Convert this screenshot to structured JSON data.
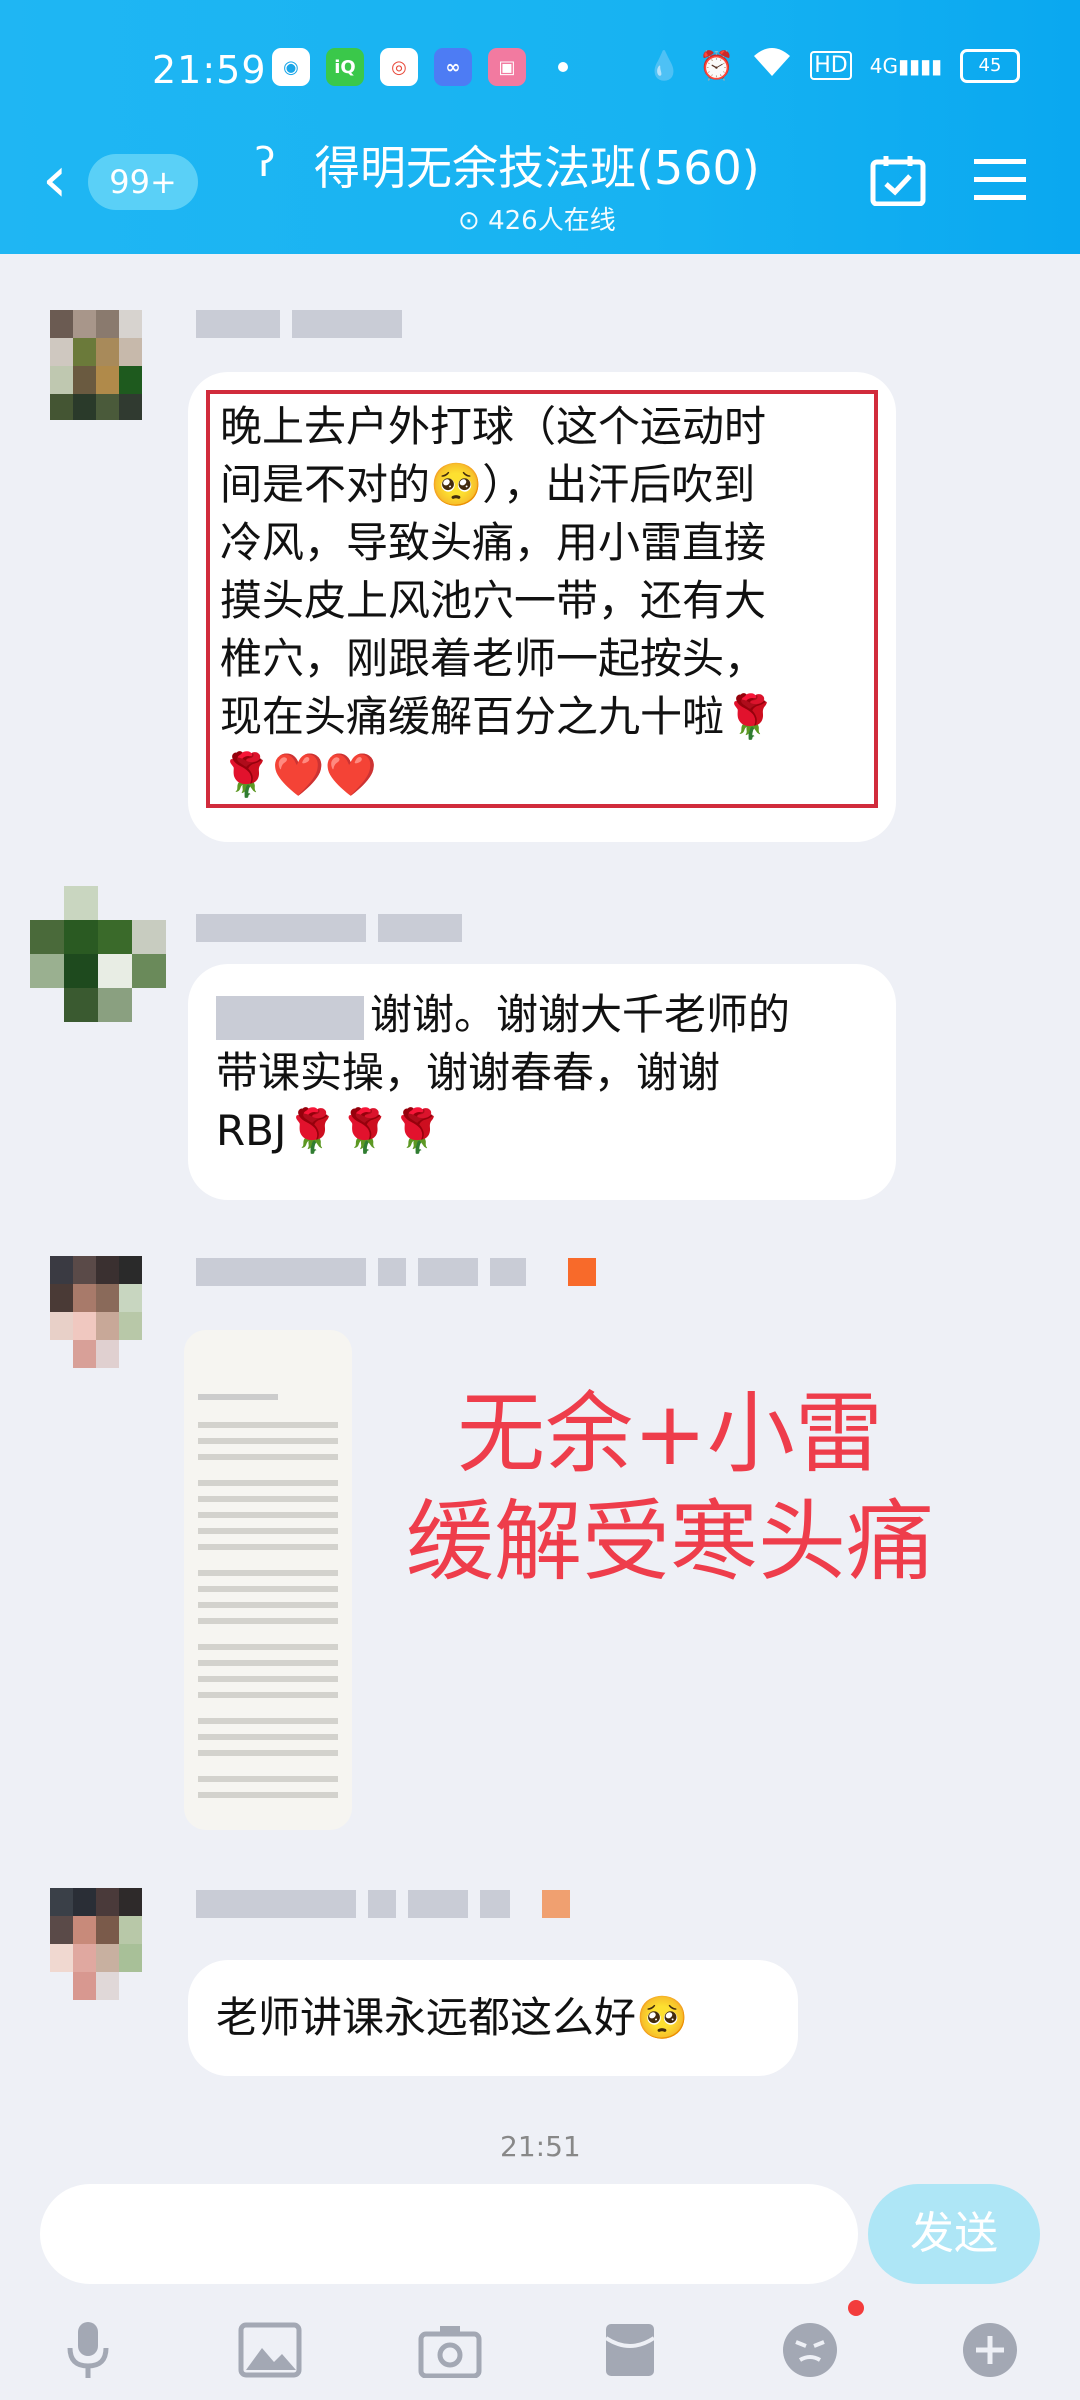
{
  "status": {
    "time": "21:59",
    "app_icons": [
      "bubble-icon",
      "iqiyi-icon",
      "browser-icon",
      "infinity-icon",
      "bilibili-icon"
    ],
    "hd": "HD",
    "network": "4G",
    "battery": "45"
  },
  "header": {
    "back_badge": "99+",
    "title": "得明无余技法班(560)",
    "online": "426人在线"
  },
  "messages": [
    {
      "lines": [
        "晚上去户外打球（这个运动时",
        "间是不对的🥺），出汗后吹到",
        "冷风，导致头痛，用小雷直接",
        "摸头皮上风池穴一带，还有大",
        "椎穴，刚跟着老师一起按头，",
        "现在头痛缓解百分之九十啦🌹",
        "🌹❤️❤️"
      ]
    },
    {
      "lines": [
        "谢谢。谢谢大千老师的",
        "带课实操，谢谢春春，谢谢",
        "RBJ🌹🌹🌹"
      ]
    },
    {
      "lines": [
        "老师讲课永远都这么好🥺"
      ]
    }
  ],
  "annotation": {
    "line1": "无余+小雷",
    "line2": "缓解受寒头痛",
    "color": "#ee3d4b"
  },
  "divider_time": "21:51",
  "input": {
    "send_label": "发送"
  },
  "toolbar": [
    "microphone-icon",
    "image-icon",
    "camera-icon",
    "red-packet-icon",
    "emoji-icon",
    "plus-icon"
  ]
}
